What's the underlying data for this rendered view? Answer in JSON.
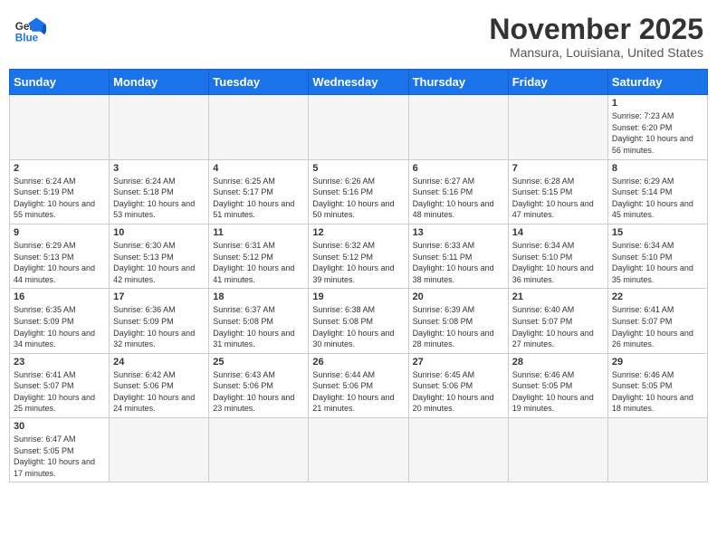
{
  "header": {
    "logo_text_regular": "General",
    "logo_text_blue": "Blue",
    "month_title": "November 2025",
    "location": "Mansura, Louisiana, United States"
  },
  "weekdays": [
    "Sunday",
    "Monday",
    "Tuesday",
    "Wednesday",
    "Thursday",
    "Friday",
    "Saturday"
  ],
  "days": {
    "1": {
      "sunrise": "7:23 AM",
      "sunset": "6:20 PM",
      "daylight": "10 hours and 56 minutes."
    },
    "2": {
      "sunrise": "6:24 AM",
      "sunset": "5:19 PM",
      "daylight": "10 hours and 55 minutes."
    },
    "3": {
      "sunrise": "6:24 AM",
      "sunset": "5:18 PM",
      "daylight": "10 hours and 53 minutes."
    },
    "4": {
      "sunrise": "6:25 AM",
      "sunset": "5:17 PM",
      "daylight": "10 hours and 51 minutes."
    },
    "5": {
      "sunrise": "6:26 AM",
      "sunset": "5:16 PM",
      "daylight": "10 hours and 50 minutes."
    },
    "6": {
      "sunrise": "6:27 AM",
      "sunset": "5:16 PM",
      "daylight": "10 hours and 48 minutes."
    },
    "7": {
      "sunrise": "6:28 AM",
      "sunset": "5:15 PM",
      "daylight": "10 hours and 47 minutes."
    },
    "8": {
      "sunrise": "6:29 AM",
      "sunset": "5:14 PM",
      "daylight": "10 hours and 45 minutes."
    },
    "9": {
      "sunrise": "6:29 AM",
      "sunset": "5:13 PM",
      "daylight": "10 hours and 44 minutes."
    },
    "10": {
      "sunrise": "6:30 AM",
      "sunset": "5:13 PM",
      "daylight": "10 hours and 42 minutes."
    },
    "11": {
      "sunrise": "6:31 AM",
      "sunset": "5:12 PM",
      "daylight": "10 hours and 41 minutes."
    },
    "12": {
      "sunrise": "6:32 AM",
      "sunset": "5:12 PM",
      "daylight": "10 hours and 39 minutes."
    },
    "13": {
      "sunrise": "6:33 AM",
      "sunset": "5:11 PM",
      "daylight": "10 hours and 38 minutes."
    },
    "14": {
      "sunrise": "6:34 AM",
      "sunset": "5:10 PM",
      "daylight": "10 hours and 36 minutes."
    },
    "15": {
      "sunrise": "6:34 AM",
      "sunset": "5:10 PM",
      "daylight": "10 hours and 35 minutes."
    },
    "16": {
      "sunrise": "6:35 AM",
      "sunset": "5:09 PM",
      "daylight": "10 hours and 34 minutes."
    },
    "17": {
      "sunrise": "6:36 AM",
      "sunset": "5:09 PM",
      "daylight": "10 hours and 32 minutes."
    },
    "18": {
      "sunrise": "6:37 AM",
      "sunset": "5:08 PM",
      "daylight": "10 hours and 31 minutes."
    },
    "19": {
      "sunrise": "6:38 AM",
      "sunset": "5:08 PM",
      "daylight": "10 hours and 30 minutes."
    },
    "20": {
      "sunrise": "6:39 AM",
      "sunset": "5:08 PM",
      "daylight": "10 hours and 28 minutes."
    },
    "21": {
      "sunrise": "6:40 AM",
      "sunset": "5:07 PM",
      "daylight": "10 hours and 27 minutes."
    },
    "22": {
      "sunrise": "6:41 AM",
      "sunset": "5:07 PM",
      "daylight": "10 hours and 26 minutes."
    },
    "23": {
      "sunrise": "6:41 AM",
      "sunset": "5:07 PM",
      "daylight": "10 hours and 25 minutes."
    },
    "24": {
      "sunrise": "6:42 AM",
      "sunset": "5:06 PM",
      "daylight": "10 hours and 24 minutes."
    },
    "25": {
      "sunrise": "6:43 AM",
      "sunset": "5:06 PM",
      "daylight": "10 hours and 23 minutes."
    },
    "26": {
      "sunrise": "6:44 AM",
      "sunset": "5:06 PM",
      "daylight": "10 hours and 21 minutes."
    },
    "27": {
      "sunrise": "6:45 AM",
      "sunset": "5:06 PM",
      "daylight": "10 hours and 20 minutes."
    },
    "28": {
      "sunrise": "6:46 AM",
      "sunset": "5:05 PM",
      "daylight": "10 hours and 19 minutes."
    },
    "29": {
      "sunrise": "6:46 AM",
      "sunset": "5:05 PM",
      "daylight": "10 hours and 18 minutes."
    },
    "30": {
      "sunrise": "6:47 AM",
      "sunset": "5:05 PM",
      "daylight": "10 hours and 17 minutes."
    }
  }
}
